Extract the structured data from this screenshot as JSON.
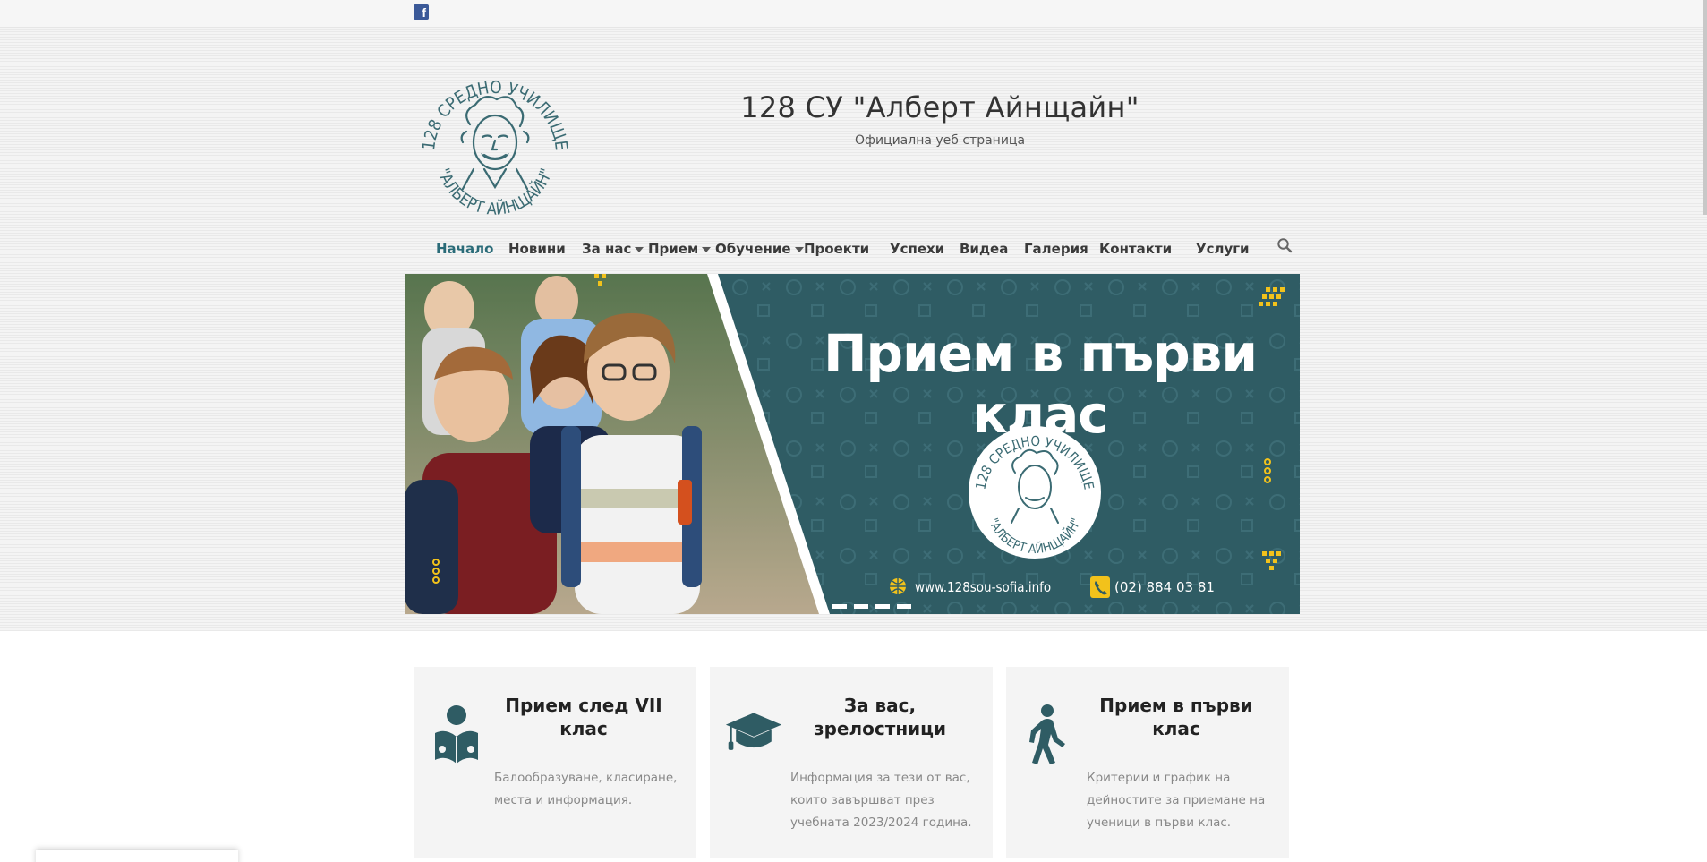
{
  "topbar": {
    "facebook_icon": "facebook-icon",
    "facebook_glyph": "f"
  },
  "header": {
    "title": "128 СУ \"Алберт Айнщайн\"",
    "tagline": "Официална уеб страница",
    "logo_text_top": "128 СРЕДНО УЧИЛИЩЕ",
    "logo_text_bottom": "\"АЛБЕРТ АЙНЩАЙН\"",
    "colors": {
      "brand": "#2f5c64",
      "accent": "#f2c21b"
    }
  },
  "nav": {
    "items": [
      {
        "label": "Начало",
        "active": true,
        "dropdown": false
      },
      {
        "label": "Новини",
        "active": false,
        "dropdown": false
      },
      {
        "label": "За нас",
        "active": false,
        "dropdown": true
      },
      {
        "label": "Прием",
        "active": false,
        "dropdown": true
      },
      {
        "label": "Обучение",
        "active": false,
        "dropdown": true
      },
      {
        "label": "Проекти",
        "active": false,
        "dropdown": false
      },
      {
        "label": "Успехи",
        "active": false,
        "dropdown": false
      },
      {
        "label": "Видеа",
        "active": false,
        "dropdown": false
      },
      {
        "label": "Галерия",
        "active": false,
        "dropdown": false
      },
      {
        "label": "Контакти",
        "active": false,
        "dropdown": false
      },
      {
        "label": "Услуги",
        "active": false,
        "dropdown": false
      }
    ],
    "search_icon": "search-icon"
  },
  "banner": {
    "title": "Прием в първи клас",
    "url": "www.128sou-sofia.info",
    "phone": "(02) 884 03 81",
    "badge_text_top": "128 СРЕДНО УЧИЛИЩЕ",
    "badge_text_bottom": "\"АЛБЕРТ АЙНЩАЙН\"",
    "slide_count": 4
  },
  "features": [
    {
      "icon": "reading-person-icon",
      "title": "Прием след VII клас",
      "text": "Балообразуване, класиране, места и информация."
    },
    {
      "icon": "graduation-cap-icon",
      "title": "За вас, зрелостници",
      "text": "Информация за тези от вас, които завършват през учебната 2023/2024 година."
    },
    {
      "icon": "walking-person-icon",
      "title": "Прием в първи клас",
      "text": "Критерии и график на дейностите за приемане на ученици в първи клас."
    }
  ]
}
